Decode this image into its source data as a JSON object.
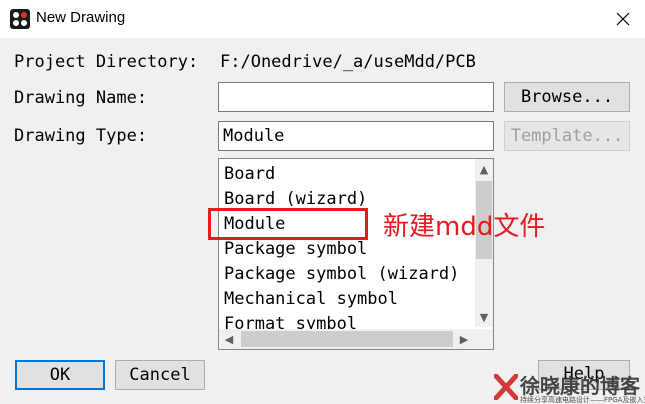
{
  "window": {
    "title": "New Drawing",
    "close_icon": "close-icon",
    "app_icon": "orcad-app-icon"
  },
  "form": {
    "project_directory_label": "Project Directory:",
    "project_directory_value": "F:/Onedrive/_a/useMdd/PCB",
    "drawing_name_label": "Drawing Name:",
    "drawing_name_value": "",
    "drawing_type_label": "Drawing Type:",
    "drawing_type_value": "Module"
  },
  "buttons": {
    "browse": "Browse...",
    "template": "Template...",
    "ok": "OK",
    "cancel": "Cancel",
    "help": "Help"
  },
  "drawing_types": [
    "Board",
    "Board (wizard)",
    "Module",
    "Package symbol",
    "Package symbol (wizard)",
    "Mechanical symbol",
    "Format symbol"
  ],
  "selected_type": "Module",
  "annotation": {
    "text": "新建mdd文件",
    "color": "#e8191f"
  },
  "watermark": {
    "title": "徐晓康的博客",
    "subtitle": "持续分享高速电路设计——FPGA及嵌入式开发技术"
  }
}
